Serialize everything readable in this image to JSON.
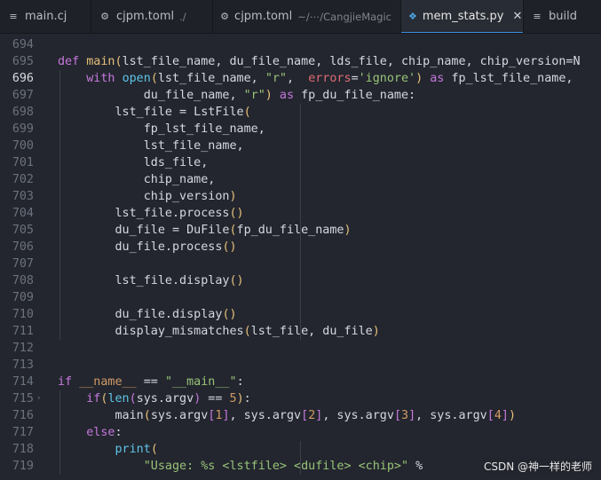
{
  "tabs": [
    {
      "icon": "list-icon",
      "name": "main.cj",
      "path": "",
      "active": false,
      "closable": false
    },
    {
      "icon": "gear-icon",
      "name": "cjpm.toml",
      "path": "./",
      "active": false,
      "closable": false
    },
    {
      "icon": "gear-icon",
      "name": "cjpm.toml",
      "path": "~/⋯/CangjieMagic",
      "active": false,
      "closable": false
    },
    {
      "icon": "python-icon",
      "name": "mem_stats.py",
      "path": "",
      "active": true,
      "closable": true
    },
    {
      "icon": "list-icon",
      "name": "build",
      "path": "",
      "active": false,
      "closable": false
    }
  ],
  "editor": {
    "file": "mem_stats.py",
    "current_line": 696,
    "lines": [
      {
        "num": "694",
        "tokens": []
      },
      {
        "num": "695",
        "tokens": [
          [
            "kw",
            "def "
          ],
          [
            "fn",
            "main"
          ],
          [
            "br",
            "("
          ],
          [
            "tx",
            "lst_file_name, du_file_name, lds_file, chip_name, chip_version=N"
          ]
        ]
      },
      {
        "num": "696",
        "tokens": [
          [
            "tx",
            "    "
          ],
          [
            "kw",
            "with "
          ],
          [
            "bi",
            "open"
          ],
          [
            "br",
            "("
          ],
          [
            "tx",
            "lst_file_name, "
          ],
          [
            "st",
            "\"r\""
          ],
          [
            "tx",
            ",  "
          ],
          [
            "pa",
            "errors"
          ],
          [
            "op",
            "="
          ],
          [
            "st",
            "'ignore'"
          ],
          [
            "br",
            ")"
          ],
          [
            "kw",
            " as "
          ],
          [
            "tx",
            "fp_lst_file_name,"
          ]
        ]
      },
      {
        "num": "697",
        "tokens": [
          [
            "tx",
            "            du_file_name, "
          ],
          [
            "st",
            "\"r\""
          ],
          [
            "br",
            ")"
          ],
          [
            "kw",
            " as "
          ],
          [
            "tx",
            "fp_du_file_name:"
          ]
        ]
      },
      {
        "num": "698",
        "tokens": [
          [
            "tx",
            "        lst_file = LstFile"
          ],
          [
            "br",
            "("
          ]
        ]
      },
      {
        "num": "699",
        "tokens": [
          [
            "tx",
            "            fp_lst_file_name,"
          ]
        ]
      },
      {
        "num": "700",
        "tokens": [
          [
            "tx",
            "            lst_file_name,"
          ]
        ]
      },
      {
        "num": "701",
        "tokens": [
          [
            "tx",
            "            lds_file,"
          ]
        ]
      },
      {
        "num": "702",
        "tokens": [
          [
            "tx",
            "            chip_name,"
          ]
        ]
      },
      {
        "num": "703",
        "tokens": [
          [
            "tx",
            "            chip_version"
          ],
          [
            "br",
            ")"
          ]
        ]
      },
      {
        "num": "704",
        "tokens": [
          [
            "tx",
            "        lst_file.process"
          ],
          [
            "br",
            "()"
          ]
        ]
      },
      {
        "num": "705",
        "tokens": [
          [
            "tx",
            "        du_file = DuFile"
          ],
          [
            "br",
            "("
          ],
          [
            "tx",
            "fp_du_file_name"
          ],
          [
            "br",
            ")"
          ]
        ]
      },
      {
        "num": "706",
        "tokens": [
          [
            "tx",
            "        du_file.process"
          ],
          [
            "br",
            "()"
          ]
        ]
      },
      {
        "num": "707",
        "tokens": []
      },
      {
        "num": "708",
        "tokens": [
          [
            "tx",
            "        lst_file.display"
          ],
          [
            "br",
            "()"
          ]
        ]
      },
      {
        "num": "709",
        "tokens": []
      },
      {
        "num": "710",
        "tokens": [
          [
            "tx",
            "        du_file.display"
          ],
          [
            "br",
            "()"
          ]
        ]
      },
      {
        "num": "711",
        "tokens": [
          [
            "tx",
            "        display_mismatches"
          ],
          [
            "br",
            "("
          ],
          [
            "tx",
            "lst_file, du_file"
          ],
          [
            "br",
            ")"
          ]
        ]
      },
      {
        "num": "712",
        "tokens": []
      },
      {
        "num": "713",
        "tokens": []
      },
      {
        "num": "714",
        "tokens": [
          [
            "kw",
            "if "
          ],
          [
            "dn",
            "__name__"
          ],
          [
            "op",
            " == "
          ],
          [
            "st",
            "\"__main__\""
          ],
          [
            "tx",
            ":"
          ]
        ]
      },
      {
        "num": "715",
        "tokens": [
          [
            "tx",
            "    "
          ],
          [
            "kw",
            "if"
          ],
          [
            "br",
            "("
          ],
          [
            "bi",
            "len"
          ],
          [
            "bp",
            "("
          ],
          [
            "tx",
            "sys.argv"
          ],
          [
            "bp",
            ")"
          ],
          [
            "op",
            " == "
          ],
          [
            "nm",
            "5"
          ],
          [
            "br",
            ")"
          ],
          [
            "tx",
            ":"
          ]
        ]
      },
      {
        "num": "716",
        "tokens": [
          [
            "tx",
            "        main"
          ],
          [
            "br",
            "("
          ],
          [
            "tx",
            "sys.argv"
          ],
          [
            "bp",
            "["
          ],
          [
            "nm",
            "1"
          ],
          [
            "bp",
            "]"
          ],
          [
            "tx",
            ", sys.argv"
          ],
          [
            "bp",
            "["
          ],
          [
            "nm",
            "2"
          ],
          [
            "bp",
            "]"
          ],
          [
            "tx",
            ", sys.argv"
          ],
          [
            "bp",
            "["
          ],
          [
            "nm",
            "3"
          ],
          [
            "bp",
            "]"
          ],
          [
            "tx",
            ", sys.argv"
          ],
          [
            "bp",
            "["
          ],
          [
            "nm",
            "4"
          ],
          [
            "bp",
            "]"
          ],
          [
            "br",
            ")"
          ]
        ]
      },
      {
        "num": "717",
        "tokens": [
          [
            "tx",
            "    "
          ],
          [
            "kw",
            "else"
          ],
          [
            "tx",
            ":"
          ]
        ]
      },
      {
        "num": "718",
        "tokens": [
          [
            "tx",
            "        "
          ],
          [
            "bi",
            "print"
          ],
          [
            "br",
            "("
          ]
        ]
      },
      {
        "num": "719",
        "tokens": [
          [
            "tx",
            "            "
          ],
          [
            "st",
            "\"Usage: %s <lstfile> <dufile> <chip>\""
          ],
          [
            "op",
            " %"
          ]
        ]
      }
    ]
  },
  "watermark": "CSDN @神一样的老师",
  "colors": {
    "background": "#23262e",
    "keyword": "#c678dd",
    "function": "#e5c07b",
    "builtin": "#5ec4e6",
    "string": "#98c379",
    "number": "#d19a66",
    "param": "#e06c75",
    "tab_accent": "#3d8fe0"
  }
}
